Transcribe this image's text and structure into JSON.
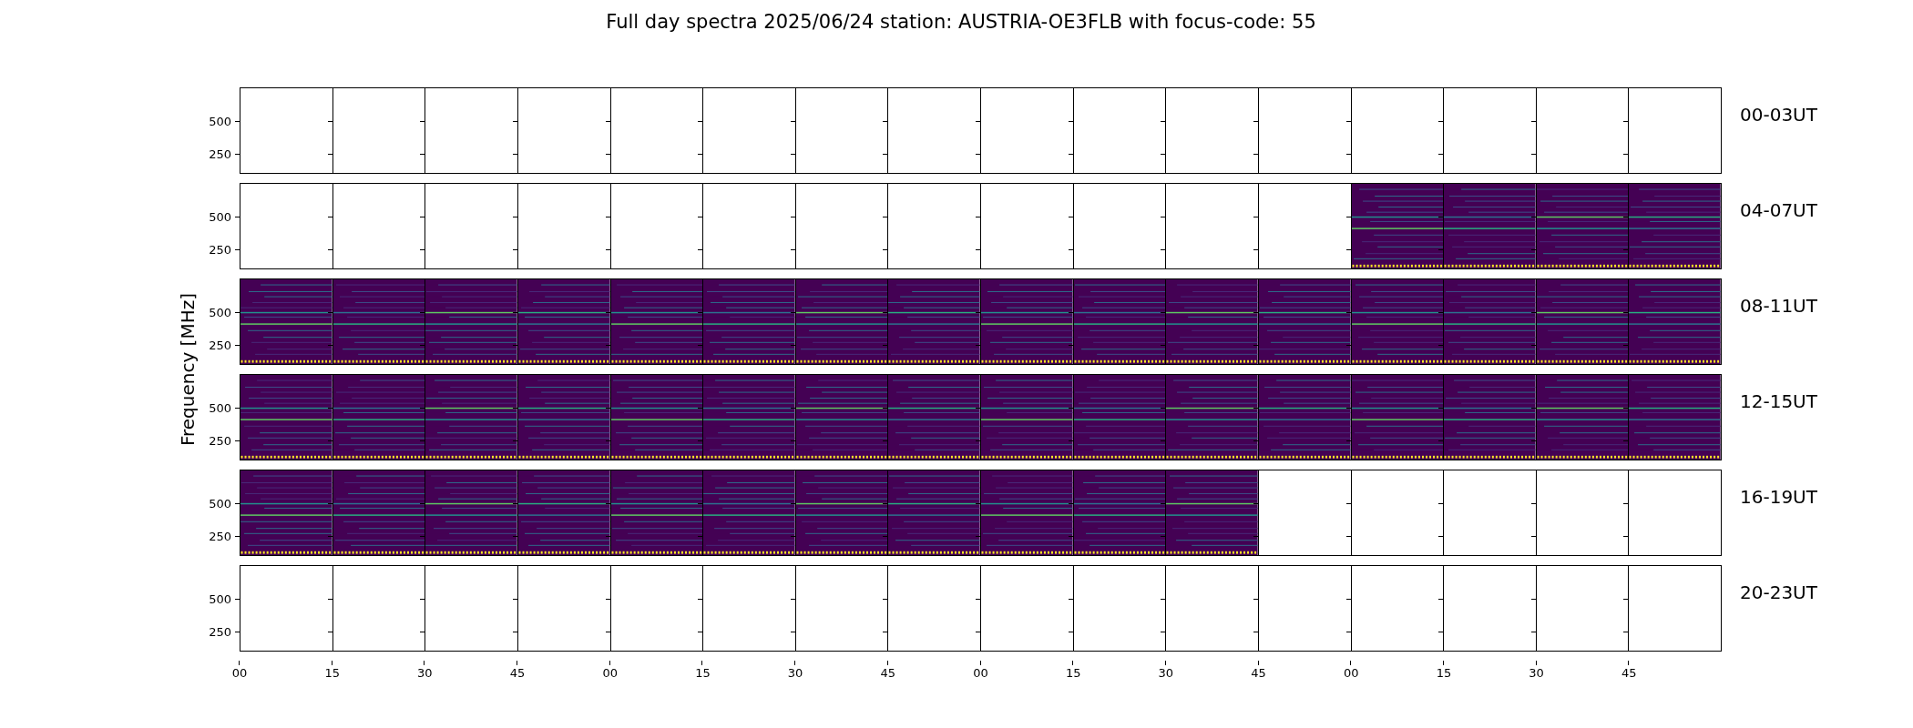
{
  "title": "Full day spectra 2025/06/24 station: AUSTRIA-OE3FLB with focus-code: 55",
  "ylabel": "Frequency [MHz]",
  "xticks": [
    "00",
    "15",
    "30",
    "45",
    "00",
    "15",
    "30",
    "45",
    "00",
    "15",
    "30",
    "45",
    "00",
    "15",
    "30",
    "45"
  ],
  "rows": [
    {
      "label": "00-03UT",
      "yticks": [
        "500",
        "250"
      ],
      "panels": [
        {
          "kind": "empty"
        },
        {
          "kind": "empty"
        },
        {
          "kind": "empty"
        },
        {
          "kind": "empty"
        },
        {
          "kind": "empty"
        },
        {
          "kind": "empty"
        },
        {
          "kind": "empty"
        },
        {
          "kind": "empty"
        },
        {
          "kind": "empty"
        },
        {
          "kind": "empty"
        },
        {
          "kind": "empty"
        },
        {
          "kind": "empty"
        },
        {
          "kind": "empty"
        },
        {
          "kind": "empty"
        },
        {
          "kind": "empty"
        },
        {
          "kind": "empty"
        }
      ]
    },
    {
      "label": "04-07UT",
      "yticks": [
        "500",
        "250"
      ],
      "panels": [
        {
          "kind": "empty"
        },
        {
          "kind": "empty"
        },
        {
          "kind": "empty"
        },
        {
          "kind": "empty"
        },
        {
          "kind": "empty"
        },
        {
          "kind": "empty"
        },
        {
          "kind": "empty"
        },
        {
          "kind": "empty"
        },
        {
          "kind": "empty"
        },
        {
          "kind": "empty"
        },
        {
          "kind": "empty"
        },
        {
          "kind": "empty"
        },
        {
          "kind": "spectrum"
        },
        {
          "kind": "spectrum"
        },
        {
          "kind": "spectrum"
        },
        {
          "kind": "spectrum"
        }
      ]
    },
    {
      "label": "08-11UT",
      "yticks": [
        "500",
        "250"
      ],
      "panels": [
        {
          "kind": "spectrum"
        },
        {
          "kind": "spectrum"
        },
        {
          "kind": "spectrum"
        },
        {
          "kind": "spectrum"
        },
        {
          "kind": "spectrum"
        },
        {
          "kind": "spectrum"
        },
        {
          "kind": "spectrum"
        },
        {
          "kind": "spectrum"
        },
        {
          "kind": "spectrum"
        },
        {
          "kind": "spectrum"
        },
        {
          "kind": "spectrum"
        },
        {
          "kind": "spectrum"
        },
        {
          "kind": "spectrum"
        },
        {
          "kind": "spectrum"
        },
        {
          "kind": "spectrum"
        },
        {
          "kind": "spectrum"
        }
      ]
    },
    {
      "label": "12-15UT",
      "yticks": [
        "500",
        "250"
      ],
      "panels": [
        {
          "kind": "spectrum"
        },
        {
          "kind": "spectrum"
        },
        {
          "kind": "spectrum"
        },
        {
          "kind": "spectrum"
        },
        {
          "kind": "spectrum"
        },
        {
          "kind": "spectrum"
        },
        {
          "kind": "spectrum"
        },
        {
          "kind": "spectrum"
        },
        {
          "kind": "spectrum"
        },
        {
          "kind": "spectrum"
        },
        {
          "kind": "spectrum"
        },
        {
          "kind": "spectrum"
        },
        {
          "kind": "spectrum"
        },
        {
          "kind": "spectrum"
        },
        {
          "kind": "spectrum"
        },
        {
          "kind": "spectrum"
        }
      ]
    },
    {
      "label": "16-19UT",
      "yticks": [
        "500",
        "250"
      ],
      "panels": [
        {
          "kind": "spectrum"
        },
        {
          "kind": "spectrum"
        },
        {
          "kind": "spectrum"
        },
        {
          "kind": "spectrum"
        },
        {
          "kind": "spectrum"
        },
        {
          "kind": "spectrum"
        },
        {
          "kind": "spectrum"
        },
        {
          "kind": "spectrum"
        },
        {
          "kind": "spectrum"
        },
        {
          "kind": "spectrum"
        },
        {
          "kind": "spectrum"
        },
        {
          "kind": "empty"
        },
        {
          "kind": "empty"
        },
        {
          "kind": "empty"
        },
        {
          "kind": "empty"
        },
        {
          "kind": "empty"
        }
      ]
    },
    {
      "label": "20-23UT",
      "yticks": [
        "500",
        "250"
      ],
      "panels": [
        {
          "kind": "empty"
        },
        {
          "kind": "empty"
        },
        {
          "kind": "empty"
        },
        {
          "kind": "empty"
        },
        {
          "kind": "empty"
        },
        {
          "kind": "empty"
        },
        {
          "kind": "empty"
        },
        {
          "kind": "empty"
        },
        {
          "kind": "empty"
        },
        {
          "kind": "empty"
        },
        {
          "kind": "empty"
        },
        {
          "kind": "empty"
        },
        {
          "kind": "empty"
        },
        {
          "kind": "empty"
        },
        {
          "kind": "empty"
        },
        {
          "kind": "empty"
        }
      ]
    }
  ]
}
